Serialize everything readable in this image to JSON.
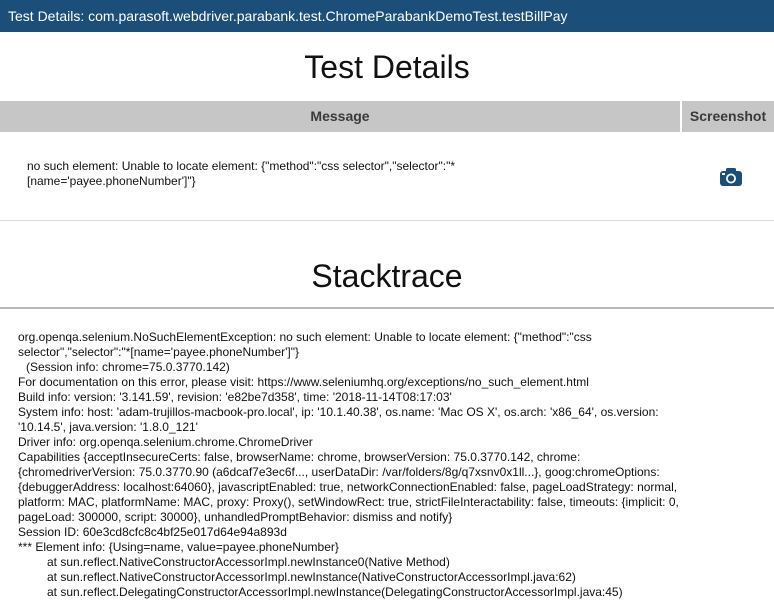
{
  "window": {
    "title": "Test Details: com.parasoft.webdriver.parabank.test.ChromeParabankDemoTest.testBillPay"
  },
  "page": {
    "heading": "Test Details",
    "stacktrace_heading": "Stacktrace"
  },
  "table": {
    "headers": {
      "message": "Message",
      "screenshot": "Screenshot"
    },
    "row": {
      "message_line1": "no such element: Unable to locate element: {\"method\":\"css selector\",\"selector\":\"*",
      "message_line2": "[name='payee.phoneNumber']\"}",
      "screenshot_icon": "camera-icon"
    }
  },
  "colors": {
    "titlebar": "#1b4f7a",
    "table_header": "#c6c6c6",
    "camera_icon": "#1b4f7a"
  },
  "stacktrace": {
    "lines": [
      "org.openqa.selenium.NoSuchElementException: no such element: Unable to locate element: {\"method\":\"css",
      "selector\",\"selector\":\"*[name='payee.phoneNumber']\"}",
      "(Session info: chrome=75.0.3770.142)",
      "For documentation on this error, please visit: https://www.seleniumhq.org/exceptions/no_such_element.html",
      "Build info: version: '3.141.59', revision: 'e82be7d358', time: '2018-11-14T08:17:03'",
      "System info: host: 'adam-trujillos-macbook-pro.local', ip: '10.1.40.38', os.name: 'Mac OS X', os.arch: 'x86_64', os.version:",
      "'10.14.5', java.version: '1.8.0_121'",
      "Driver info: org.openqa.selenium.chrome.ChromeDriver",
      "Capabilities {acceptInsecureCerts: false, browserName: chrome, browserVersion: 75.0.3770.142, chrome:",
      "{chromedriverVersion: 75.0.3770.90 (a6dcaf7e3ec6f..., userDataDir: /var/folders/8g/q7xsnv0x1ll...}, goog:chromeOptions:",
      "{debuggerAddress: localhost:64060}, javascriptEnabled: true, networkConnectionEnabled: false, pageLoadStrategy: normal,",
      "platform: MAC, platformName: MAC, proxy: Proxy(), setWindowRect: true, strictFileInteractability: false, timeouts: {implicit: 0,",
      "pageLoad: 300000, script: 30000}, unhandledPromptBehavior: dismiss and notify}",
      "Session ID: 60e3cd8cfc8c4bf25e017d64e94a893d",
      "*** Element info: {Using=name, value=payee.phoneNumber}",
      "at sun.reflect.NativeConstructorAccessorImpl.newInstance0(Native Method)",
      "at sun.reflect.NativeConstructorAccessorImpl.newInstance(NativeConstructorAccessorImpl.java:62)",
      "at sun.reflect.DelegatingConstructorAccessorImpl.newInstance(DelegatingConstructorAccessorImpl.java:45)"
    ]
  }
}
